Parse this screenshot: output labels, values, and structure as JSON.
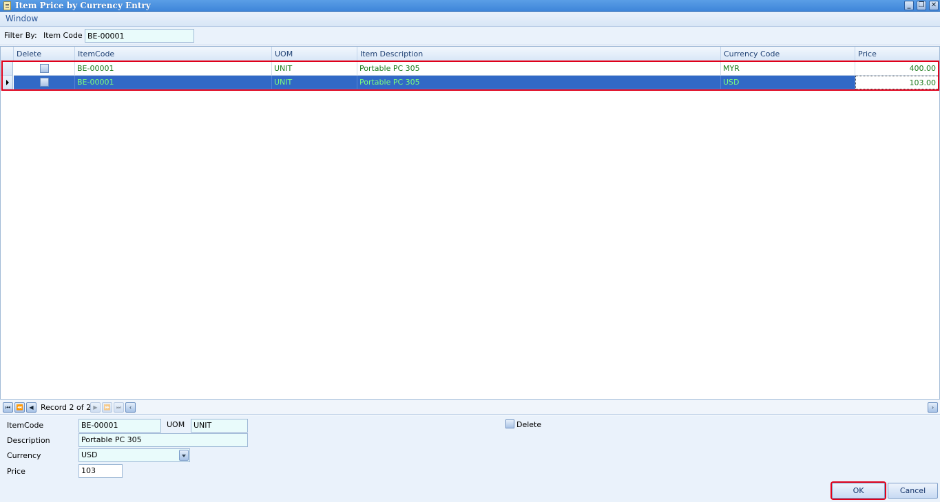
{
  "window": {
    "title": "Item Price by Currency Entry",
    "minimize_glyph": "_",
    "restore_glyph": "❐",
    "close_glyph": "✕"
  },
  "menu": {
    "window_label": "Window"
  },
  "filter": {
    "filter_by_label": "Filter By:",
    "item_code_label": "Item Code",
    "item_code_value": "BE-00001"
  },
  "grid": {
    "columns": [
      "Delete",
      "ItemCode",
      "UOM",
      "Item Description",
      "Currency Code",
      "Price"
    ],
    "rows": [
      {
        "delete": false,
        "item_code": "BE-00001",
        "uom": "UNIT",
        "description": "Portable PC 305",
        "currency": "MYR",
        "price": "400.00"
      },
      {
        "delete": false,
        "item_code": "BE-00001",
        "uom": "UNIT",
        "description": "Portable PC 305",
        "currency": "USD",
        "price": "103.00"
      }
    ],
    "selected_row": 1
  },
  "navigator": {
    "record_text": "Record 2 of 2"
  },
  "form": {
    "itemcode_label": "ItemCode",
    "itemcode_value": "BE-00001",
    "uom_label": "UOM",
    "uom_value": "UNIT",
    "delete_label": "Delete",
    "description_label": "Description",
    "description_value": "Portable PC 305",
    "currency_label": "Currency",
    "currency_value": "USD",
    "price_label": "Price",
    "price_value": "103"
  },
  "buttons": {
    "ok_label": "OK",
    "cancel_label": "Cancel"
  },
  "colors": {
    "highlight": "#e0001a",
    "selection": "#3169c6",
    "title_bar": "#4a90de"
  }
}
